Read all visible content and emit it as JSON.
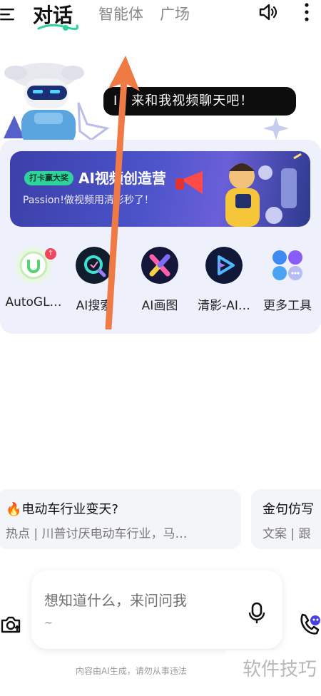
{
  "header": {
    "tabs": [
      {
        "label": "对话",
        "active": true
      },
      {
        "label": "智能体",
        "active": false
      },
      {
        "label": "广场",
        "active": false
      }
    ],
    "icons": [
      "menu-icon",
      "speaker-icon",
      "more-vertical-icon"
    ]
  },
  "hero": {
    "bubble_text": "I，来和我视频聊天吧！"
  },
  "banner": {
    "tag": "打卡赢大奖",
    "title": "AI视频创造营",
    "subtitle": "Passion!做视频用清影秒了！"
  },
  "tools": [
    {
      "label": "AutoGL…",
      "icon": "autoglm-icon",
      "badge": true
    },
    {
      "label": "AI搜索",
      "icon": "ai-search-icon"
    },
    {
      "label": "AI画图",
      "icon": "ai-draw-icon"
    },
    {
      "label": "清影-AI…",
      "icon": "qingying-video-icon"
    },
    {
      "label": "更多工具",
      "icon": "more-tools-icon"
    }
  ],
  "suggestions": [
    {
      "title": "🔥电动车行业变天?",
      "subtitle": "热点 | 川普讨厌电动车行业，马…"
    },
    {
      "title": "金句仿写",
      "subtitle": "文案 | 跟"
    }
  ],
  "input": {
    "placeholder": "想知道什么，来问问我",
    "sub": "~"
  },
  "footer": {
    "disclaimer": "内容由AI生成，请勿从事违法",
    "watermark": "软件技巧"
  },
  "colors": {
    "accent_green": "#2fd39c",
    "annotation_arrow": "#f07a45",
    "panel_bg": "#eef0fb"
  }
}
